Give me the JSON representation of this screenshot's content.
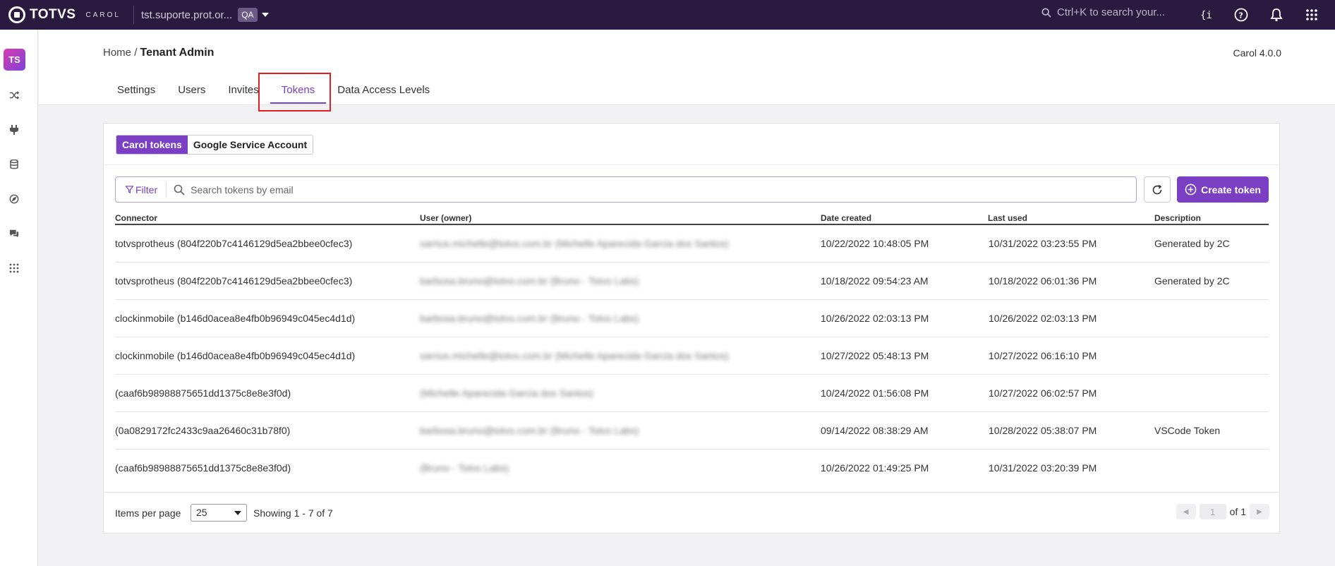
{
  "topbar": {
    "logo_text": "TOTVS",
    "logo_sub": "CAROL",
    "tenant": "tst.suporte.prot.or...",
    "env_badge": "QA",
    "search_placeholder": "Ctrl+K to search your..."
  },
  "sidebar": {
    "avatar": "TS",
    "icons": [
      "shuffle-icon",
      "plug-icon",
      "database-icon",
      "compass-icon",
      "chat-icon",
      "apps-grid-icon"
    ]
  },
  "header": {
    "breadcrumb_home": "Home",
    "breadcrumb_sep": "/",
    "breadcrumb_current": "Tenant Admin",
    "version": "Carol 4.0.0",
    "tabs": [
      "Settings",
      "Users",
      "Invites",
      "Tokens",
      "Data Access Levels"
    ],
    "active_tab": "Tokens"
  },
  "toggle": {
    "on_label": "Carol tokens",
    "off_label": "Google Service Account"
  },
  "filter": {
    "label": "Filter",
    "search_placeholder": "Search tokens by email"
  },
  "create_button": "Create token",
  "table": {
    "columns": [
      "Connector",
      "User (owner)",
      "Date created",
      "Last used",
      "Description"
    ],
    "rows": [
      {
        "connector": "totvsprotheus (804f220b7c4146129d5ea2bbee0cfec3)",
        "owner": "sarrius.michelle@totvs.com.br (Michelle Aparecida Garcia dos Santos)",
        "created": "10/22/2022 10:48:05 PM",
        "last_used": "10/31/2022 03:23:55 PM",
        "description": "Generated by 2C"
      },
      {
        "connector": "totvsprotheus (804f220b7c4146129d5ea2bbee0cfec3)",
        "owner": "barbosa.bruno@totvs.com.br (Bruno - Totvs Labs)",
        "created": "10/18/2022 09:54:23 AM",
        "last_used": "10/18/2022 06:01:36 PM",
        "description": "Generated by 2C"
      },
      {
        "connector": "clockinmobile (b146d0acea8e4fb0b96949c045ec4d1d)",
        "owner": "barbosa.bruno@totvs.com.br (Bruno - Totvs Labs)",
        "created": "10/26/2022 02:03:13 PM",
        "last_used": "10/26/2022 02:03:13 PM",
        "description": ""
      },
      {
        "connector": "clockinmobile (b146d0acea8e4fb0b96949c045ec4d1d)",
        "owner": "sarrius.michelle@totvs.com.br (Michelle Aparecida Garcia dos Santos)",
        "created": "10/27/2022 05:48:13 PM",
        "last_used": "10/27/2022 06:16:10 PM",
        "description": ""
      },
      {
        "connector": "(caaf6b98988875651dd1375c8e8e3f0d)",
        "owner": "(Michelle Aparecida Garcia dos Santos)",
        "created": "10/24/2022 01:56:08 PM",
        "last_used": "10/27/2022 06:02:57 PM",
        "description": ""
      },
      {
        "connector": "(0a0829172fc2433c9aa26460c31b78f0)",
        "owner": "barbosa.bruno@totvs.com.br (Bruno - Totvs Labs)",
        "created": "09/14/2022 08:38:29 AM",
        "last_used": "10/28/2022 05:38:07 PM",
        "description": "VSCode Token"
      },
      {
        "connector": "(caaf6b98988875651dd1375c8e8e3f0d)",
        "owner": "(Bruno - Totvs Labs)",
        "created": "10/26/2022 01:49:25 PM",
        "last_used": "10/31/2022 03:20:39 PM",
        "description": ""
      }
    ]
  },
  "footer": {
    "items_per_page_label": "Items per page",
    "items_per_page_value": "25",
    "showing": "Showing 1 - 7 of 7",
    "page_value": "1",
    "page_of": "of 1"
  }
}
